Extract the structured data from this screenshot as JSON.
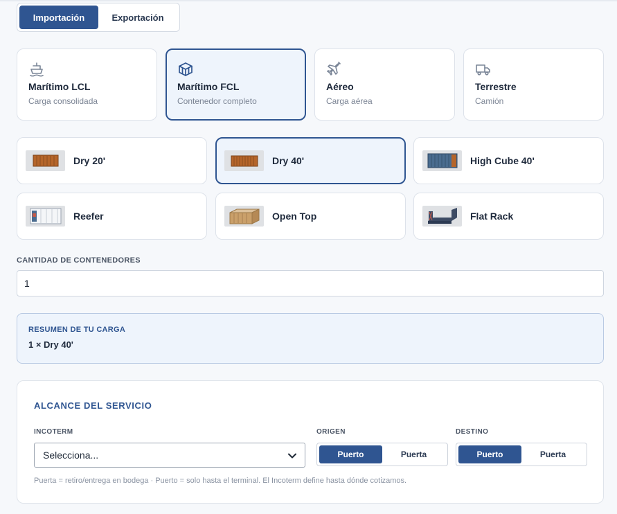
{
  "operation_toggle": {
    "options": [
      "Importación",
      "Exportación"
    ],
    "selected": "Importación"
  },
  "transport_modes": [
    {
      "title": "Marítimo LCL",
      "subtitle": "Carga consolidada",
      "icon": "ship-icon",
      "active": false
    },
    {
      "title": "Marítimo FCL",
      "subtitle": "Contenedor completo",
      "icon": "container-box-icon",
      "active": true
    },
    {
      "title": "Aéreo",
      "subtitle": "Carga aérea",
      "icon": "plane-icon",
      "active": false
    },
    {
      "title": "Terrestre",
      "subtitle": "Camión",
      "icon": "truck-icon",
      "active": false
    }
  ],
  "container_types": [
    {
      "label": "Dry 20'",
      "active": false,
      "color": "#b5652a"
    },
    {
      "label": "Dry 40'",
      "active": true,
      "color": "#b5652a"
    },
    {
      "label": "High Cube 40'",
      "active": false,
      "color": "#4a6c8f"
    },
    {
      "label": "Reefer",
      "active": false,
      "color": "#f4f6f8"
    },
    {
      "label": "Open Top",
      "active": false,
      "color": "#caa06a"
    },
    {
      "label": "Flat Rack",
      "active": false,
      "color": "#3c4a63"
    }
  ],
  "quantity": {
    "label": "CANTIDAD DE CONTENEDORES",
    "value": "1"
  },
  "summary": {
    "heading": "RESUMEN DE TU CARGA",
    "value": "1 × Dry 40'"
  },
  "service_scope": {
    "title": "ALCANCE DEL SERVICIO",
    "incoterm": {
      "label": "INCOTERM",
      "value": "Selecciona..."
    },
    "origin": {
      "label": "ORIGEN",
      "options": [
        "Puerto",
        "Puerta"
      ],
      "selected": "Puerto"
    },
    "destination": {
      "label": "DESTINO",
      "options": [
        "Puerto",
        "Puerta"
      ],
      "selected": "Puerto"
    },
    "note": "Puerta = retiro/entrega en bodega · Puerto = solo hasta el terminal. El Incoterm define hasta dónde cotizamos."
  },
  "colors": {
    "accent": "#2f5591",
    "active_bg": "#eef4fc"
  }
}
